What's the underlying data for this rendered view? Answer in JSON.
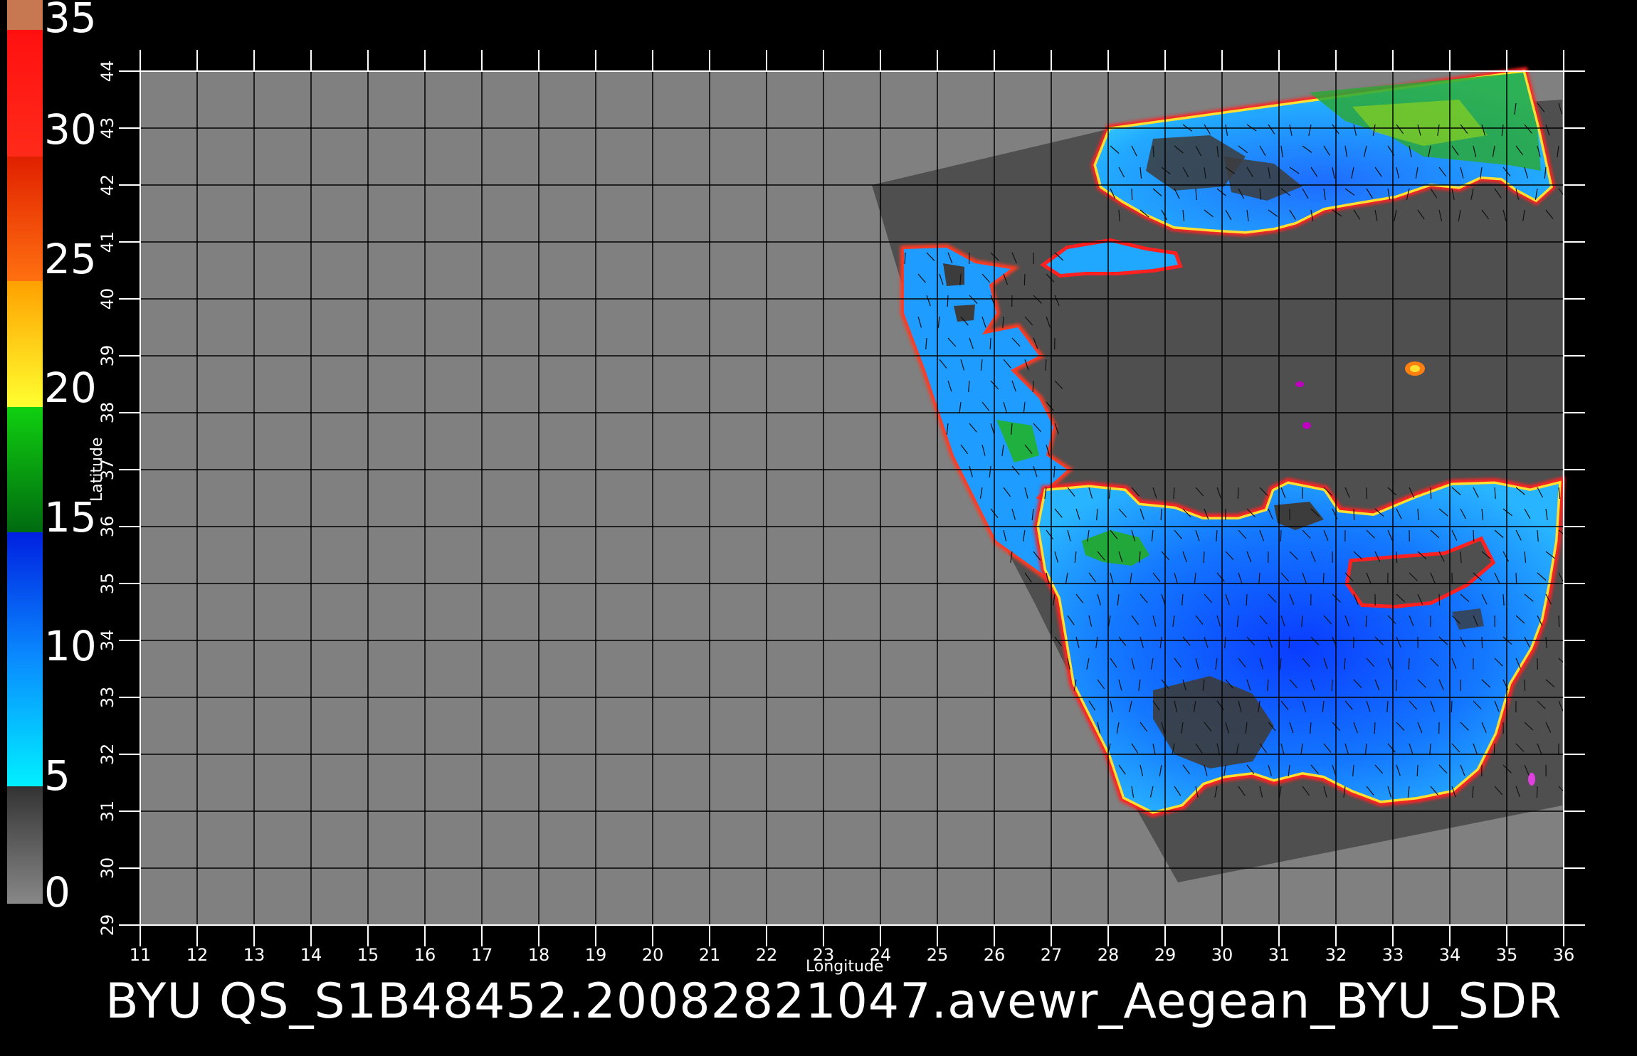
{
  "title": "BYU  QS_S1B48452.20082821047.avewr_Aegean_BYU_SDR",
  "axis": {
    "x_label": "Longitude",
    "y_label": "Latitude",
    "lon_range": [
      11,
      36
    ],
    "lat_range": [
      29,
      44
    ],
    "lon_ticks": [
      "11",
      "12",
      "13",
      "14",
      "15",
      "16",
      "17",
      "18",
      "19",
      "20",
      "21",
      "22",
      "23",
      "24",
      "25",
      "26",
      "27",
      "28",
      "29",
      "30",
      "31",
      "32",
      "33",
      "34",
      "35",
      "36"
    ],
    "lat_ticks": [
      "29",
      "30",
      "31",
      "32",
      "33",
      "34",
      "35",
      "36",
      "37",
      "38",
      "39",
      "40",
      "41",
      "42",
      "43",
      "44"
    ],
    "grid": true
  },
  "colorbar": {
    "labels": [
      "35",
      "30",
      "25",
      "20",
      "15",
      "10",
      "5",
      "0"
    ],
    "segments": [
      {
        "from": 0,
        "to": 5,
        "color_low": "#888888",
        "color_high": "#3a3a3a"
      },
      {
        "from": 5,
        "to": 15,
        "color_low": "#00f0ff",
        "color_high": "#0020e0"
      },
      {
        "from": 15,
        "to": 20,
        "color_low": "#006a10",
        "color_high": "#10d010"
      },
      {
        "from": 20,
        "to": 25,
        "color_low": "#ffff30",
        "color_high": "#ffa000"
      },
      {
        "from": 25,
        "to": 30,
        "color_low": "#ff7010",
        "color_high": "#e02000"
      },
      {
        "from": 30,
        "to": 34,
        "color_low": "#ff1a1a",
        "color_high": "#ff1010"
      },
      {
        "from": 34,
        "to": 35,
        "color_low": "#c87850",
        "color_high": "#c87850"
      }
    ]
  },
  "colors": {
    "background": "#000000",
    "map_gray": "#808080",
    "swath_gray": "#4f4f4f",
    "land_dark": "#3c3c3c",
    "grid": "#000000",
    "text": "#ffffff"
  }
}
